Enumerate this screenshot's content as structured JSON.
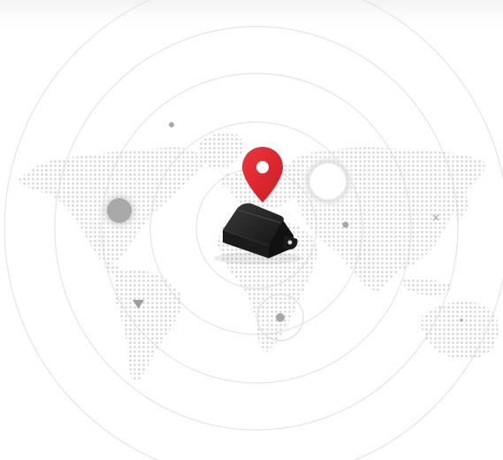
{
  "scene": {
    "description_icons": {
      "map": "world-map-dotted",
      "marker": "map-pin-icon",
      "device": "gps-tracker-device"
    },
    "colors": {
      "background": "#ffffff",
      "map_dots": "#d9d9d9",
      "rings": "#e3e3e3",
      "pin": "#e3262e",
      "device": "#1f1f1f",
      "blips": "#a8a8a8"
    }
  }
}
